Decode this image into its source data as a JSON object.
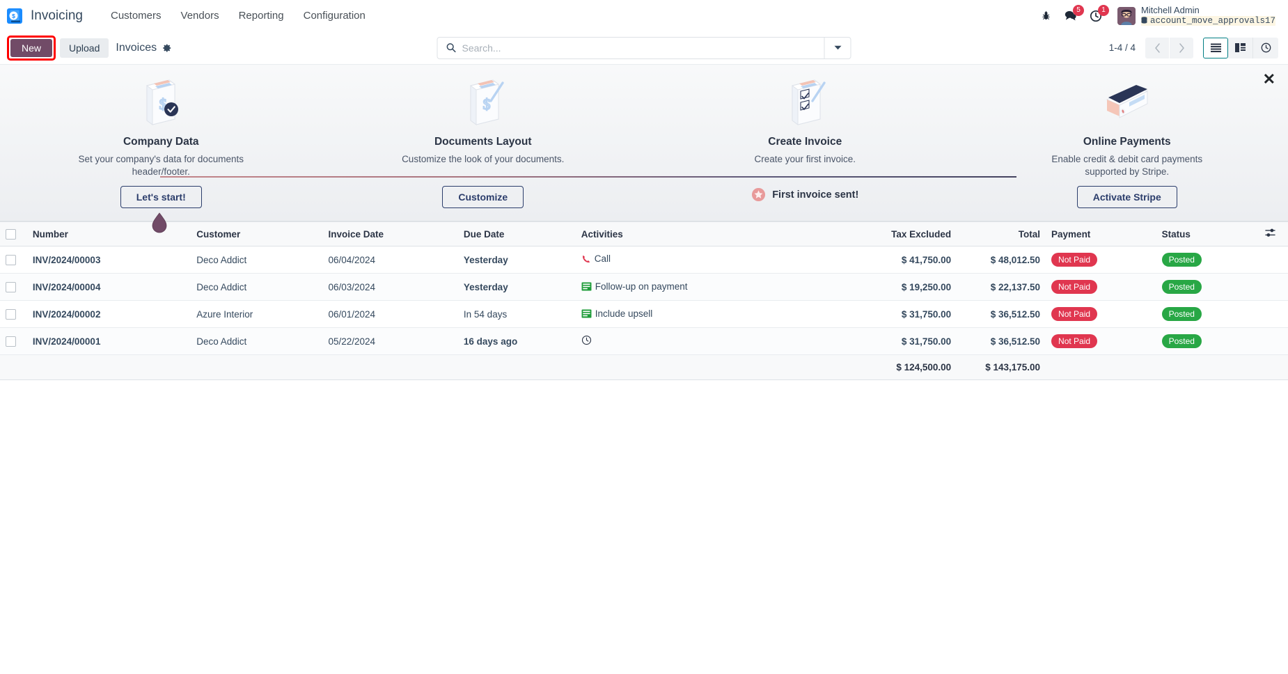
{
  "navbar": {
    "logo_icon": "odoo-invoicing-logo",
    "app_name": "Invoicing",
    "menu": [
      {
        "label": "Customers",
        "name": "customers"
      },
      {
        "label": "Vendors",
        "name": "vendors"
      },
      {
        "label": "Reporting",
        "name": "reporting"
      },
      {
        "label": "Configuration",
        "name": "configuration"
      }
    ],
    "sys_icons": [
      {
        "name": "bug-icon",
        "badge": ""
      },
      {
        "name": "messages-icon",
        "badge": "5"
      },
      {
        "name": "activities-clock-icon",
        "badge": "1"
      }
    ],
    "user": {
      "name": "Mitchell Admin",
      "database": "account_move_approvals17",
      "db_icon": "database-icon",
      "avatar_icon": "avatar"
    }
  },
  "control_panel": {
    "new_label": "New",
    "upload_label": "Upload",
    "breadcrumb": "Invoices",
    "gear_icon": "gear-icon",
    "search": {
      "placeholder": "Search...",
      "value": "",
      "search_icon": "search-icon",
      "dropdown_icon": "chevron-down-icon"
    },
    "pager": "1-4 / 4",
    "prev_icon": "chevron-left-icon",
    "next_icon": "chevron-right-icon",
    "views": [
      {
        "name": "list-view",
        "icon": "list-icon",
        "active": true
      },
      {
        "name": "kanban-view",
        "icon": "kanban-icon",
        "active": false
      },
      {
        "name": "activity-view",
        "icon": "clock-icon",
        "active": false
      }
    ]
  },
  "onboarding": {
    "close_icon": "close-icon",
    "steps": [
      {
        "art": "company-data-art",
        "title": "Company Data",
        "desc": "Set your company's data for documents header/footer.",
        "button": "Let's start!",
        "done_label": null
      },
      {
        "art": "documents-layout-art",
        "title": "Documents Layout",
        "desc": "Customize the look of your documents.",
        "button": "Customize",
        "done_label": null
      },
      {
        "art": "create-invoice-art",
        "title": "Create Invoice",
        "desc": "Create your first invoice.",
        "button": null,
        "done_label": "First invoice sent!",
        "done_icon": "star-icon"
      },
      {
        "art": "online-payments-art",
        "title": "Online Payments",
        "desc": "Enable credit & debit card payments supported by Stripe.",
        "button": "Activate Stripe",
        "done_label": null
      }
    ]
  },
  "list": {
    "columns": [
      "Number",
      "Customer",
      "Invoice Date",
      "Due Date",
      "Activities",
      "Tax Excluded",
      "Total",
      "Payment",
      "Status"
    ],
    "optional_columns_icon": "column-settings-icon",
    "select_all_icon": "checkbox",
    "rows": [
      {
        "number": "INV/2024/00003",
        "customer": "Deco Addict",
        "invoice_date": "06/04/2024",
        "due_date": "Yesterday",
        "due_date_overdue": true,
        "activity": "Call",
        "activity_icon": "phone-icon",
        "tax_excluded": "$ 41,750.00",
        "total": "$ 48,012.50",
        "payment": "Not Paid",
        "status": "Posted"
      },
      {
        "number": "INV/2024/00004",
        "customer": "Deco Addict",
        "invoice_date": "06/03/2024",
        "due_date": "Yesterday",
        "due_date_overdue": true,
        "activity": "Follow-up on payment",
        "activity_icon": "email-icon",
        "tax_excluded": "$ 19,250.00",
        "total": "$ 22,137.50",
        "payment": "Not Paid",
        "status": "Posted"
      },
      {
        "number": "INV/2024/00002",
        "customer": "Azure Interior",
        "invoice_date": "06/01/2024",
        "due_date": "In 54 days",
        "due_date_overdue": false,
        "activity": "Include upsell",
        "activity_icon": "email-icon",
        "tax_excluded": "$ 31,750.00",
        "total": "$ 36,512.50",
        "payment": "Not Paid",
        "status": "Posted"
      },
      {
        "number": "INV/2024/00001",
        "customer": "Deco Addict",
        "invoice_date": "05/22/2024",
        "due_date": "16 days ago",
        "due_date_overdue": true,
        "activity": "",
        "activity_icon": "clock-outline-icon",
        "tax_excluded": "$ 31,750.00",
        "total": "$ 36,512.50",
        "payment": "Not Paid",
        "status": "Posted"
      }
    ],
    "totals": {
      "tax_excluded": "$ 124,500.00",
      "total": "$ 143,175.00"
    }
  },
  "colors": {
    "brand_purple": "#714b67",
    "accent_teal": "#017e84",
    "danger_red": "#e0364f",
    "success_green": "#28a745",
    "highlight_red": "#ff0000"
  }
}
